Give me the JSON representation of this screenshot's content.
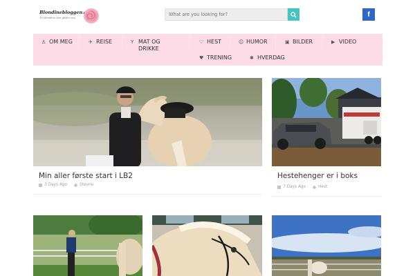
{
  "header": {
    "logo_text": "Blondinebloggen",
    "logo_suffix": ".no",
    "logo_tagline": "En blondine som gleder seg",
    "search_placeholder": "What are you looking for?",
    "facebook_label": "f"
  },
  "nav": {
    "items": [
      {
        "label": "OM MEG",
        "icon": "person-icon"
      },
      {
        "label": "REISE",
        "icon": "airplane-icon"
      },
      {
        "label": "MAT OG DRIKKE",
        "icon": "glass-icon"
      },
      {
        "label": "HEST",
        "icon": "heart-outline-icon"
      },
      {
        "label": "HUMOR",
        "icon": "smile-icon"
      },
      {
        "label": "BILDER",
        "icon": "image-icon"
      },
      {
        "label": "VIDEO",
        "icon": "play-icon"
      },
      {
        "label": "TRENING",
        "icon": "heart-icon"
      },
      {
        "label": "HVERDAG",
        "icon": "asterisk-icon"
      }
    ]
  },
  "posts": [
    {
      "title": "Min aller første start i LB2",
      "date": "3 Days Ago",
      "tag": "Stevne"
    },
    {
      "title": "Hestehenger er i boks",
      "date": "7 Days Ago",
      "tag": "Hest"
    }
  ],
  "colors": {
    "nav_bg": "#fddbe7",
    "search_button": "#45c2c2",
    "facebook": "#2d69c2"
  }
}
